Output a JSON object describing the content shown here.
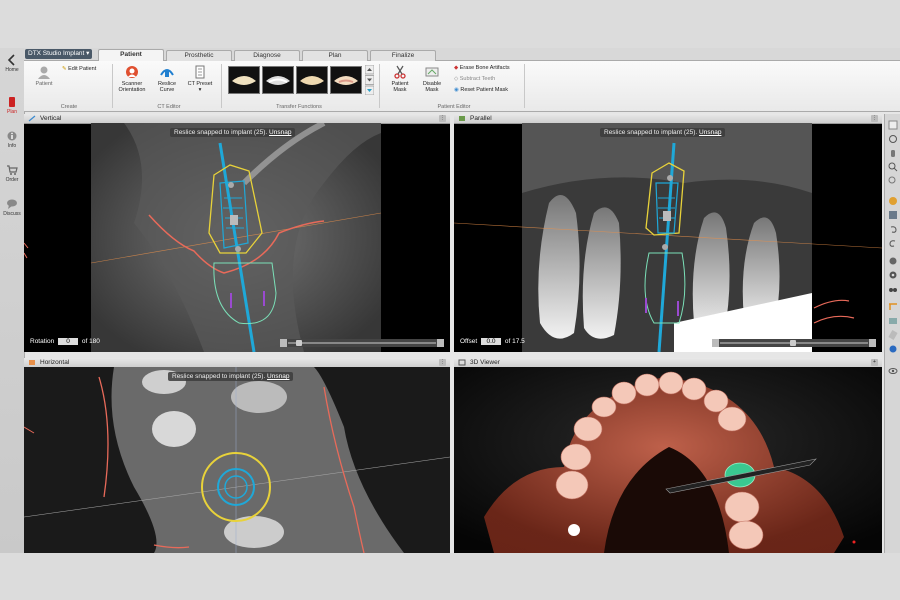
{
  "nav": {
    "home": "Home",
    "plan": "Plan",
    "info": "Info",
    "order": "Order",
    "discuss": "Discuss"
  },
  "app": {
    "title": "DTX Studio Implant"
  },
  "tabs": [
    "Patient",
    "Prosthetic",
    "Diagnose",
    "Plan",
    "Finalize"
  ],
  "ribbon": {
    "create": {
      "label": "Create",
      "patient": "Patient",
      "edit_patient": "Edit Patient"
    },
    "ct_editor": {
      "label": "CT Editor",
      "scanner_orientation": "Scanner Orientation",
      "reslice_curve": "Reslice Curve",
      "ct_preset": "CT Preset"
    },
    "transfer_functions": {
      "label": "Transfer Functions"
    },
    "patient_editor": {
      "label": "Patient Editor",
      "patient_mask": "Patient Mask",
      "disable_mask": "Disable Mask",
      "erase_bone_artifacts": "Erase Bone Artifacts",
      "subtract_teeth": "Subtract Teeth",
      "reset_patient_mask": "Reset Patient Mask"
    }
  },
  "viewports": {
    "vertical": {
      "title": "Vertical",
      "toast": "Reslice snapped to implant (25).",
      "unsnap": "Unsnap",
      "footer_label": "Rotation",
      "value": "0",
      "of": "of 180"
    },
    "parallel": {
      "title": "Parallel",
      "toast": "Reslice snapped to implant (25).",
      "unsnap": "Unsnap",
      "footer_label": "Offset",
      "value": "0.0",
      "of": "of 17.5"
    },
    "horizontal": {
      "title": "Horizontal",
      "toast": "Reslice snapped to implant (25).",
      "unsnap": "Unsnap"
    },
    "viewer3d": {
      "title": "3D Viewer"
    }
  },
  "colors": {
    "implant_axis": "#1fa8d8",
    "implant_outline": "#e8d23a",
    "nerve_curve": "#e86a5a",
    "accent_nav": "#cc2222"
  }
}
